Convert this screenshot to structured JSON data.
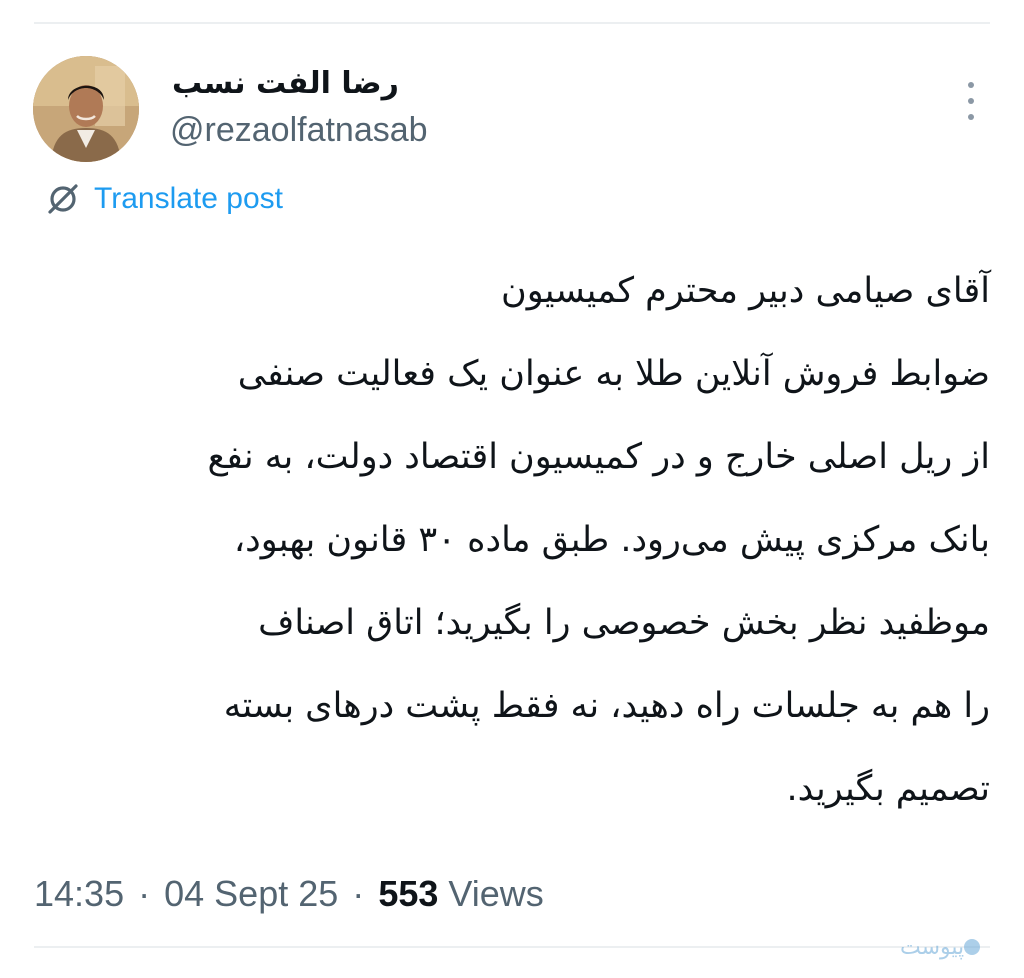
{
  "user": {
    "display_name": "رضا الفت نسب",
    "handle": "@rezaolfatnasab"
  },
  "actions": {
    "translate_label": "Translate post",
    "more_icon": "more-vertical-icon"
  },
  "tweet": {
    "lines": [
      "آقای صیامی دبیر محترم کمیسیون",
      "ضوابط فروش آنلاین طلا به عنوان یک فعالیت صنفی",
      "از ریل اصلی خارج و در کمیسیون اقتصاد دولت، به نفع",
      "بانک مرکزی پیش می‌رود. طبق ماده ۳۰ قانون بهبود،",
      "موظفید نظر بخش خصوصی را بگیرید؛ اتاق اصناف",
      "را هم به جلسات راه دهید، نه فقط پشت درهای بسته",
      "تصمیم بگیرید."
    ]
  },
  "meta": {
    "time": "14:35",
    "date": "04 Sept 25",
    "views_count": "553",
    "views_label": "Views",
    "separator": "·"
  },
  "watermark": {
    "text": "پیوست"
  },
  "colors": {
    "link": "#1d9bf0",
    "text_primary": "#0f1419",
    "text_secondary": "#536471",
    "divider": "#eceff1"
  }
}
